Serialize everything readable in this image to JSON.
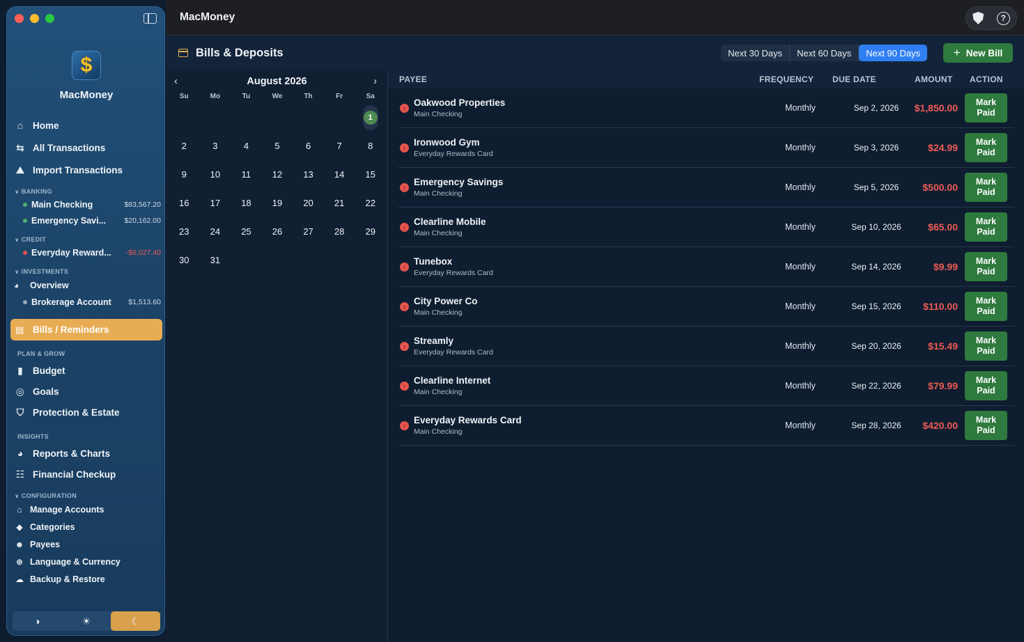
{
  "window": {
    "title": "MacMoney"
  },
  "sidebar": {
    "app_name": "MacMoney",
    "logo_glyph": "$",
    "nav": [
      {
        "label": "Home",
        "icon": "house-icon"
      },
      {
        "label": "All Transactions",
        "icon": "arrows-swap-icon"
      },
      {
        "label": "Import Transactions",
        "icon": "import-tray-icon"
      }
    ],
    "sections": {
      "banking": "BANKING",
      "credit": "CREDIT",
      "investments": "INVESTMENTS",
      "plan": "PLAN & GROW",
      "insights": "INSIGHTS",
      "configuration": "CONFIGURATION"
    },
    "banking_accounts": [
      {
        "name": "Main Checking",
        "balance": "$83,567.20",
        "dot": "#4caf6a"
      },
      {
        "name": "Emergency Savi...",
        "balance": "$20,162.00",
        "dot": "#4caf6a"
      }
    ],
    "credit_accounts": [
      {
        "name": "Everyday Reward...",
        "balance": "-$6,027.40",
        "dot": "#e5544d"
      }
    ],
    "investments": {
      "overview": "Overview",
      "accounts": [
        {
          "name": "Brokerage Account",
          "balance": "$1,513.60",
          "dot": "#9aa8b6"
        }
      ]
    },
    "bills": "Bills / Reminders",
    "plan_items": [
      "Budget",
      "Goals",
      "Protection & Estate"
    ],
    "insight_items": [
      "Reports & Charts",
      "Financial Checkup"
    ],
    "config_items": [
      "Manage Accounts",
      "Categories",
      "Payees",
      "Language & Currency",
      "Backup & Restore"
    ],
    "theme_options": [
      "◑",
      "☀",
      "☾"
    ],
    "theme_selected": "dark"
  },
  "header": {
    "title": "Bills & Deposits",
    "ranges": [
      "Next 30 Days",
      "Next 60 Days",
      "Next 90 Days"
    ],
    "active_range": "Next 90 Days",
    "new_bill": "New Bill"
  },
  "calendar": {
    "month": "August 2026",
    "dow": [
      "Su",
      "Mo",
      "Tu",
      "We",
      "Th",
      "Fr",
      "Sa"
    ],
    "first_weekday": 6,
    "days": 31,
    "selected": 1
  },
  "table": {
    "columns": {
      "payee": "PAYEE",
      "frequency": "FREQUENCY",
      "due": "DUE DATE",
      "amount": "AMOUNT",
      "action": "ACTION"
    },
    "mark_label_1": "Mark",
    "mark_label_2": "Paid",
    "rows": [
      {
        "payee": "Oakwood Properties",
        "account": "Main Checking",
        "frequency": "Monthly",
        "due": "Sep 2, 2026",
        "amount": "$1,850.00"
      },
      {
        "payee": "Ironwood Gym",
        "account": "Everyday Rewards Card",
        "frequency": "Monthly",
        "due": "Sep 3, 2026",
        "amount": "$24.99"
      },
      {
        "payee": "Emergency Savings",
        "account": "Main Checking",
        "frequency": "Monthly",
        "due": "Sep 5, 2026",
        "amount": "$500.00"
      },
      {
        "payee": "Clearline Mobile",
        "account": "Main Checking",
        "frequency": "Monthly",
        "due": "Sep 10, 2026",
        "amount": "$65.00"
      },
      {
        "payee": "Tunebox",
        "account": "Everyday Rewards Card",
        "frequency": "Monthly",
        "due": "Sep 14, 2026",
        "amount": "$9.99"
      },
      {
        "payee": "City Power Co",
        "account": "Main Checking",
        "frequency": "Monthly",
        "due": "Sep 15, 2026",
        "amount": "$110.00"
      },
      {
        "payee": "Streamly",
        "account": "Everyday Rewards Card",
        "frequency": "Monthly",
        "due": "Sep 20, 2026",
        "amount": "$15.49"
      },
      {
        "payee": "Clearline Internet",
        "account": "Main Checking",
        "frequency": "Monthly",
        "due": "Sep 22, 2026",
        "amount": "$79.99"
      },
      {
        "payee": "Everyday Rewards Card",
        "account": "Main Checking",
        "frequency": "Monthly",
        "due": "Sep 28, 2026",
        "amount": "$420.00"
      }
    ]
  },
  "colors": {
    "accent": "#e8ad54",
    "selected_range": "#2f7ff2",
    "mark_paid": "#2f7a3e",
    "amount": "#ef5b55"
  }
}
